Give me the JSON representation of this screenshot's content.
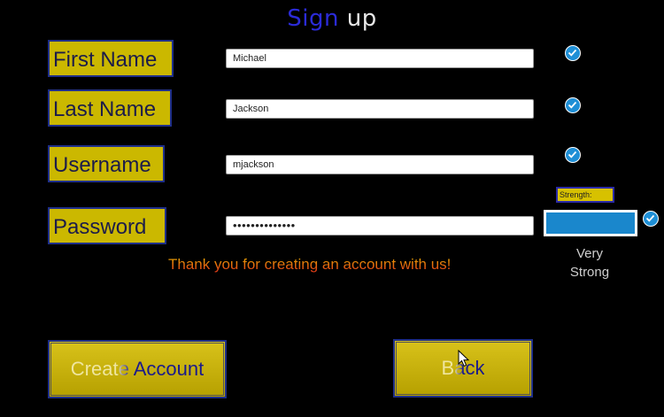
{
  "header": {
    "title_part1": "Sign",
    "title_part2": " up"
  },
  "fields": {
    "first_name": {
      "label": "First Name",
      "value": "Michael"
    },
    "last_name": {
      "label": "Last Name",
      "value": "Jackson"
    },
    "username": {
      "label": "Username",
      "value": "mjackson"
    },
    "password": {
      "label": "Password",
      "value": "••••••••••••••"
    }
  },
  "strength": {
    "label": "Strength:",
    "level_line1": "Very",
    "level_line2": "Strong",
    "fill_fraction": 1.0
  },
  "message": "Thank you for creating an account with us!",
  "buttons": {
    "create": "Create Account",
    "back": "Back"
  },
  "colors": {
    "background": "#000000",
    "accent": "#cbb800",
    "border": "#1f2f8a",
    "check": "#1e8fd6",
    "strength_fill": "#1a87cc"
  },
  "icons": [
    "check-circle-icon",
    "mouse-pointer-icon"
  ]
}
